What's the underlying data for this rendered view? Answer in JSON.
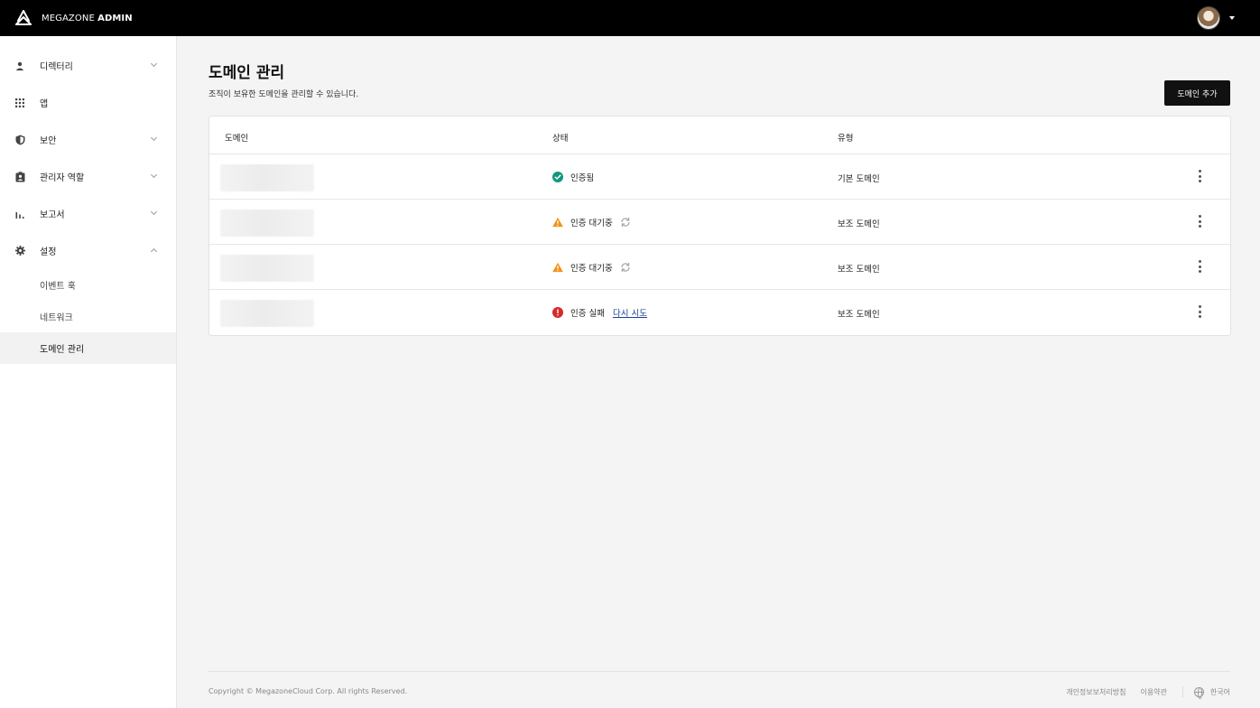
{
  "header": {
    "brand_prefix": "MEGAZONE",
    "brand_suffix": "ADMIN"
  },
  "sidebar": {
    "items": [
      {
        "label": "디렉터리",
        "icon": "person-icon",
        "expanded": false
      },
      {
        "label": "앱",
        "icon": "grid-icon"
      },
      {
        "label": "보안",
        "icon": "shield-icon",
        "expanded": false
      },
      {
        "label": "관리자 역할",
        "icon": "badge-icon",
        "expanded": false
      },
      {
        "label": "보고서",
        "icon": "bar-chart-icon",
        "expanded": false
      },
      {
        "label": "설정",
        "icon": "gear-icon",
        "expanded": true
      }
    ],
    "sub_items": [
      {
        "label": "이벤트 훅"
      },
      {
        "label": "네트워크"
      },
      {
        "label": "도메인 관리",
        "active": true
      }
    ]
  },
  "main": {
    "title": "도메인 관리",
    "description": "조직이 보유한 도메인을 관리할 수 있습니다.",
    "add_button": "도메인 추가",
    "table": {
      "headers": {
        "domain": "도메인",
        "status": "상태",
        "type": "유형"
      },
      "rows": [
        {
          "status": "인증됨",
          "status_kind": "verified",
          "type": "기본 도메인"
        },
        {
          "status": "인증 대기중",
          "status_kind": "pending",
          "type": "보조 도메인"
        },
        {
          "status": "인증 대기중",
          "status_kind": "pending",
          "type": "보조 도메인"
        },
        {
          "status": "인증 실패",
          "status_kind": "failed",
          "retry": "다시 시도",
          "type": "보조 도메인"
        }
      ]
    }
  },
  "footer": {
    "copyright": "Copyright © MegazoneCloud Corp. All rights Reserved.",
    "privacy": "개인정보보처리방침",
    "terms": "이용약관",
    "language": "한국어"
  },
  "colors": {
    "verified": "#12967f",
    "pending": "#f29216",
    "failed": "#d62b2b"
  }
}
